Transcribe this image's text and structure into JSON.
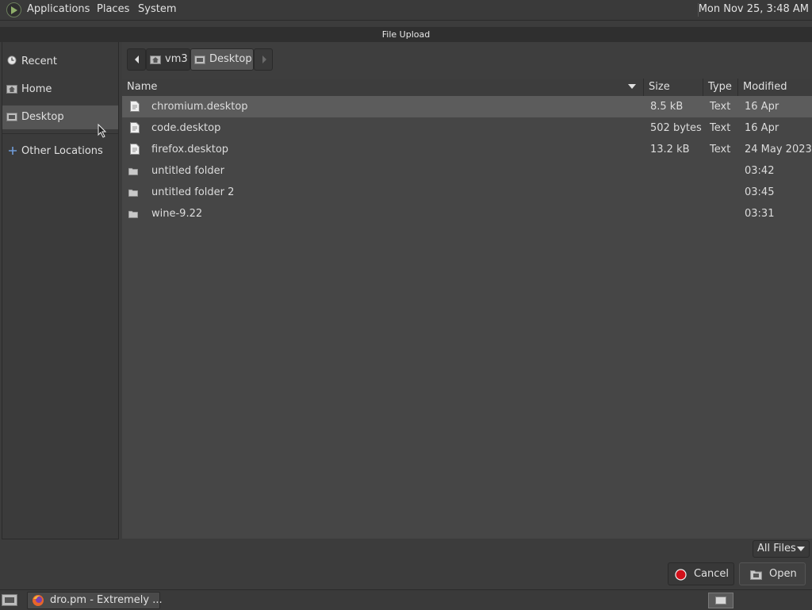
{
  "top_panel": {
    "menus": [
      "Applications",
      "Places",
      "System"
    ],
    "clock": "Mon Nov 25,  3:48 AM"
  },
  "dialog": {
    "title": "File Upload"
  },
  "sidebar": {
    "items": [
      {
        "label": "Recent",
        "icon": "clock-icon"
      },
      {
        "label": "Home",
        "icon": "home-folder-icon"
      },
      {
        "label": "Desktop",
        "icon": "desktop-folder-icon",
        "selected": true
      },
      {
        "label": "Other Locations",
        "icon": "plus-icon"
      }
    ]
  },
  "pathbar": {
    "crumbs": [
      "vm3",
      "Desktop"
    ]
  },
  "columns": {
    "name": "Name",
    "size": "Size",
    "type": "Type",
    "modified": "Modified"
  },
  "files": [
    {
      "name": "chromium.desktop",
      "size": "8.5 kB",
      "type": "Text",
      "modified": "16 Apr",
      "icon": "text-file-icon",
      "selected": true
    },
    {
      "name": "code.desktop",
      "size": "502 bytes",
      "type": "Text",
      "modified": "16 Apr",
      "icon": "text-file-icon"
    },
    {
      "name": "firefox.desktop",
      "size": "13.2 kB",
      "type": "Text",
      "modified": "24 May 2023",
      "icon": "text-file-icon"
    },
    {
      "name": "untitled folder",
      "size": "",
      "type": "",
      "modified": "03:42",
      "icon": "folder-icon"
    },
    {
      "name": "untitled folder 2",
      "size": "",
      "type": "",
      "modified": "03:45",
      "icon": "folder-icon"
    },
    {
      "name": "wine-9.22",
      "size": "",
      "type": "",
      "modified": "03:31",
      "icon": "folder-icon"
    }
  ],
  "filter": {
    "selected": "All Files"
  },
  "buttons": {
    "cancel": "Cancel",
    "open": "Open"
  },
  "taskbar": {
    "task_label": "dro.pm - Extremely ..."
  }
}
